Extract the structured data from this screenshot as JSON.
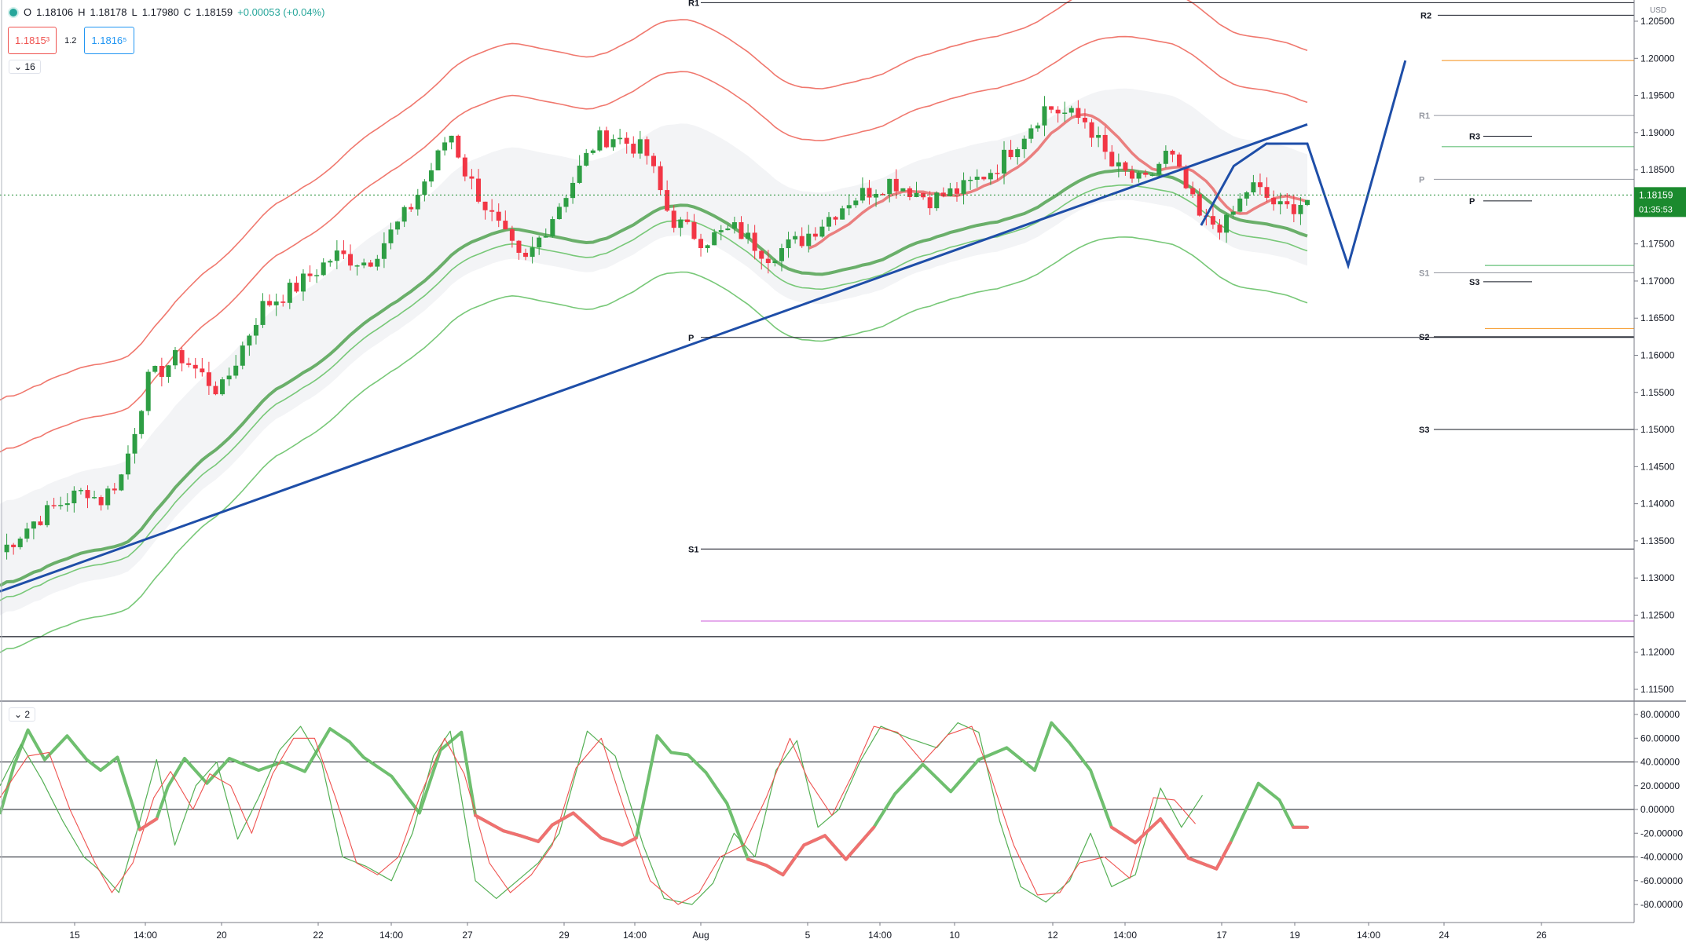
{
  "symbol_ohlc": {
    "open_label": "O",
    "open": "1.18106",
    "high_label": "H",
    "high": "1.18178",
    "low_label": "L",
    "low": "1.17980",
    "close_label": "C",
    "close": "1.18159",
    "change": "+0.00053 (+0.04%)"
  },
  "quote": {
    "sell": "1.1815³",
    "spread": "1.2",
    "buy": "1.1816⁵"
  },
  "main_pane": {
    "indicator_count": "16",
    "currency": "USD"
  },
  "osc_pane": {
    "indicator_count": "2"
  },
  "price_axis": {
    "ticks": [
      "1.20500",
      "1.20000",
      "1.19500",
      "1.19000",
      "1.18500",
      "1.18000",
      "1.17500",
      "1.17000",
      "1.16500",
      "1.16000",
      "1.15500",
      "1.15000",
      "1.14500",
      "1.14000",
      "1.13500",
      "1.13000",
      "1.12500",
      "1.12000",
      "1.11500"
    ],
    "current_price": "1.18159",
    "countdown": "01:35:53"
  },
  "osc_axis": {
    "ticks": [
      "80.00000",
      "60.00000",
      "40.00000",
      "20.00000",
      "0.00000",
      "-20.00000",
      "-40.00000",
      "-60.00000",
      "-80.00000"
    ]
  },
  "time_axis": {
    "ticks": [
      "15",
      "14:00",
      "20",
      "22",
      "14:00",
      "27",
      "29",
      "14:00",
      "Aug",
      "5",
      "14:00",
      "10",
      "12",
      "14:00",
      "17",
      "19",
      "14:00",
      "24",
      "26"
    ]
  },
  "pivots": {
    "monthly": [
      "R1",
      "R2",
      "P",
      "S1",
      "R1",
      "P",
      "S1",
      "S2",
      "S3"
    ],
    "weekly": [
      "R3",
      "P",
      "S3"
    ]
  },
  "colors": {
    "bull": "#26a69a",
    "bear": "#ef5350",
    "candle_up": "#2e9e44",
    "candle_down": "#f23645",
    "trend": "#1e4ea8",
    "band_red": "#f0786e",
    "band_green": "#78c878",
    "ma_green": "#6aaf6a",
    "ma_red": "#e86a6a",
    "price_tag": "#1b8a2e"
  },
  "chart_data": {
    "type": "line",
    "instrument_quote": "USD",
    "y_range": [
      1.111,
      1.2065
    ],
    "osc_range": [
      -88,
      85
    ],
    "last": {
      "open": 1.18106,
      "high": 1.18178,
      "low": 1.1798,
      "close": 1.18159,
      "change": 0.00053,
      "change_pct": 0.04
    },
    "close_path_anchors": [
      [
        0,
        1.1335
      ],
      [
        20,
        1.1375
      ],
      [
        40,
        1.1405
      ],
      [
        55,
        1.142
      ],
      [
        60,
        1.14
      ],
      [
        75,
        1.144
      ],
      [
        90,
        1.1565
      ],
      [
        110,
        1.16
      ],
      [
        135,
        1.155
      ],
      [
        160,
        1.1665
      ],
      [
        180,
        1.169
      ],
      [
        205,
        1.1735
      ],
      [
        225,
        1.1725
      ],
      [
        250,
        1.1795
      ],
      [
        270,
        1.1875
      ],
      [
        275,
        1.1905
      ],
      [
        285,
        1.1845
      ],
      [
        300,
        1.179
      ],
      [
        320,
        1.172
      ],
      [
        340,
        1.1795
      ],
      [
        365,
        1.189
      ],
      [
        375,
        1.1895
      ],
      [
        395,
        1.1875
      ],
      [
        410,
        1.1785
      ],
      [
        430,
        1.1755
      ],
      [
        450,
        1.177
      ],
      [
        470,
        1.1735
      ],
      [
        490,
        1.1755
      ],
      [
        520,
        1.181
      ],
      [
        545,
        1.1835
      ],
      [
        570,
        1.181
      ],
      [
        590,
        1.1825
      ],
      [
        610,
        1.1855
      ],
      [
        640,
        1.1935
      ],
      [
        665,
        1.1915
      ],
      [
        680,
        1.1855
      ],
      [
        700,
        1.183
      ],
      [
        715,
        1.1875
      ],
      [
        735,
        1.178
      ],
      [
        750,
        1.1775
      ],
      [
        765,
        1.183
      ],
      [
        785,
        1.1795
      ],
      [
        800,
        1.181
      ]
    ],
    "pivot_levels": {
      "monthly": {
        "R2": 1.2075,
        "R1": 1.2058,
        "P": 1.1624,
        "S1": 1.1339
      },
      "weekly_right": {
        "R2": 1.2049,
        "R1": 1.1923,
        "P": 1.1837,
        "S1": 1.1711,
        "S2": 1.1625,
        "S3": 1.15
      },
      "daily": {
        "R3": 1.1895,
        "P": 1.1808,
        "S3": 1.1699
      }
    },
    "horizontal_lines": [
      {
        "color": "orange",
        "y": 1.1997
      },
      {
        "color": "green",
        "y": 1.1881
      },
      {
        "color": "green",
        "y": 1.1721
      },
      {
        "color": "orange",
        "y": 1.1636
      },
      {
        "color": "magenta",
        "y": 1.1242
      },
      {
        "color": "black",
        "y": 1.1221
      }
    ],
    "trendline": [
      [
        0,
        1.1282
      ],
      [
        800,
        1.1911
      ]
    ],
    "projection_path": [
      [
        735,
        1.1775
      ],
      [
        755,
        1.1855
      ],
      [
        775,
        1.1885
      ],
      [
        800,
        1.1885
      ],
      [
        825,
        1.1721
      ],
      [
        860,
        1.1997
      ]
    ],
    "oscillator_levels": [
      40,
      0,
      -40
    ],
    "oscillator_series": [
      {
        "color": "green-thick",
        "points": [
          [
            0,
            -4
          ],
          [
            10,
            37
          ],
          [
            20,
            67
          ],
          [
            32,
            42
          ],
          [
            48,
            62
          ],
          [
            62,
            42
          ],
          [
            72,
            33
          ],
          [
            84,
            44
          ],
          [
            95,
            3
          ],
          [
            100,
            -17
          ],
          [
            112,
            -8
          ],
          [
            120,
            19
          ],
          [
            132,
            43
          ],
          [
            148,
            22
          ],
          [
            164,
            43
          ],
          [
            185,
            33
          ],
          [
            202,
            40
          ],
          [
            218,
            32
          ],
          [
            236,
            68
          ],
          [
            250,
            57
          ],
          [
            260,
            44
          ],
          [
            280,
            28
          ],
          [
            300,
            -3
          ],
          [
            315,
            50
          ],
          [
            330,
            65
          ],
          [
            340,
            -5
          ],
          [
            360,
            -18
          ],
          [
            372,
            -22
          ],
          [
            385,
            -27
          ],
          [
            395,
            -13
          ],
          [
            410,
            -3
          ],
          [
            430,
            -24
          ],
          [
            445,
            -30
          ],
          [
            455,
            -24
          ],
          [
            470,
            62
          ],
          [
            480,
            48
          ],
          [
            492,
            46
          ],
          [
            505,
            31
          ],
          [
            520,
            5
          ],
          [
            535,
            -42
          ],
          [
            548,
            -47
          ],
          [
            560,
            -55
          ],
          [
            575,
            -30
          ],
          [
            590,
            -22
          ],
          [
            605,
            -42
          ],
          [
            625,
            -15
          ],
          [
            640,
            13
          ],
          [
            660,
            38
          ],
          [
            680,
            15
          ],
          [
            700,
            42
          ],
          [
            720,
            52
          ],
          [
            740,
            33
          ],
          [
            752,
            73
          ],
          [
            765,
            56
          ],
          [
            780,
            33
          ],
          [
            795,
            -15
          ],
          [
            812,
            -28
          ],
          [
            830,
            -8
          ],
          [
            850,
            -41
          ],
          [
            870,
            -50
          ],
          [
            880,
            -28
          ],
          [
            900,
            22
          ],
          [
            915,
            8
          ],
          [
            925,
            -15
          ],
          [
            935,
            -15
          ]
        ]
      },
      {
        "color": "green-thin",
        "points": [
          [
            0,
            20
          ],
          [
            15,
            55
          ],
          [
            30,
            25
          ],
          [
            45,
            -10
          ],
          [
            60,
            -40
          ],
          [
            70,
            -50
          ],
          [
            85,
            -70
          ],
          [
            100,
            -10
          ],
          [
            112,
            42
          ],
          [
            125,
            -30
          ],
          [
            140,
            20
          ],
          [
            155,
            40
          ],
          [
            170,
            -25
          ],
          [
            185,
            10
          ],
          [
            200,
            50
          ],
          [
            215,
            70
          ],
          [
            230,
            40
          ],
          [
            245,
            -40
          ],
          [
            262,
            -48
          ],
          [
            280,
            -60
          ],
          [
            295,
            -20
          ],
          [
            310,
            45
          ],
          [
            322,
            66
          ],
          [
            340,
            -60
          ],
          [
            355,
            -75
          ],
          [
            370,
            -60
          ],
          [
            385,
            -45
          ],
          [
            400,
            -20
          ],
          [
            420,
            66
          ],
          [
            440,
            45
          ],
          [
            460,
            -30
          ],
          [
            475,
            -75
          ],
          [
            495,
            -80
          ],
          [
            510,
            -62
          ],
          [
            525,
            -20
          ],
          [
            540,
            -40
          ],
          [
            555,
            33
          ],
          [
            570,
            58
          ],
          [
            585,
            -15
          ],
          [
            600,
            0
          ],
          [
            615,
            40
          ],
          [
            630,
            70
          ],
          [
            650,
            60
          ],
          [
            670,
            52
          ],
          [
            685,
            73
          ],
          [
            700,
            65
          ],
          [
            715,
            -10
          ],
          [
            730,
            -65
          ],
          [
            748,
            -78
          ],
          [
            765,
            -60
          ],
          [
            780,
            -20
          ],
          [
            795,
            -65
          ],
          [
            812,
            -55
          ],
          [
            830,
            18
          ],
          [
            845,
            -15
          ],
          [
            860,
            12
          ]
        ]
      },
      {
        "color": "red-thin",
        "points": [
          [
            0,
            10
          ],
          [
            20,
            45
          ],
          [
            35,
            48
          ],
          [
            50,
            0
          ],
          [
            68,
            -45
          ],
          [
            80,
            -70
          ],
          [
            95,
            -45
          ],
          [
            110,
            10
          ],
          [
            122,
            32
          ],
          [
            138,
            0
          ],
          [
            150,
            30
          ],
          [
            165,
            20
          ],
          [
            180,
            -20
          ],
          [
            195,
            30
          ],
          [
            210,
            60
          ],
          [
            225,
            60
          ],
          [
            240,
            10
          ],
          [
            255,
            -45
          ],
          [
            270,
            -55
          ],
          [
            285,
            -40
          ],
          [
            300,
            10
          ],
          [
            318,
            60
          ],
          [
            332,
            30
          ],
          [
            350,
            -45
          ],
          [
            365,
            -70
          ],
          [
            380,
            -55
          ],
          [
            395,
            -30
          ],
          [
            412,
            35
          ],
          [
            430,
            60
          ],
          [
            448,
            -5
          ],
          [
            465,
            -60
          ],
          [
            485,
            -80
          ],
          [
            500,
            -70
          ],
          [
            515,
            -40
          ],
          [
            532,
            -30
          ],
          [
            548,
            10
          ],
          [
            565,
            60
          ],
          [
            578,
            25
          ],
          [
            595,
            -5
          ],
          [
            610,
            30
          ],
          [
            625,
            70
          ],
          [
            642,
            65
          ],
          [
            660,
            40
          ],
          [
            678,
            63
          ],
          [
            695,
            70
          ],
          [
            708,
            30
          ],
          [
            725,
            -30
          ],
          [
            742,
            -72
          ],
          [
            758,
            -70
          ],
          [
            772,
            -45
          ],
          [
            790,
            -40
          ],
          [
            808,
            -58
          ],
          [
            825,
            10
          ],
          [
            840,
            8
          ],
          [
            855,
            -12
          ]
        ]
      }
    ]
  }
}
